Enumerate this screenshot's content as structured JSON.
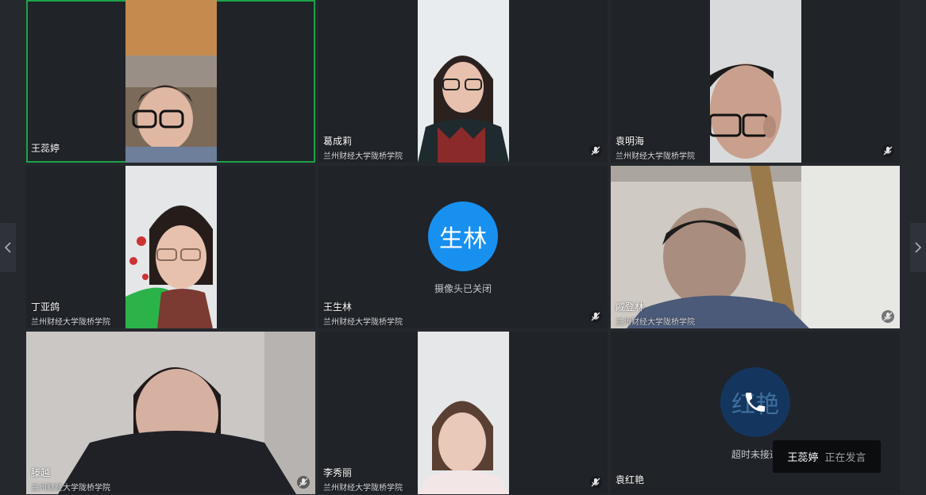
{
  "participants": [
    {
      "name": "王蕊婷",
      "org": "",
      "active": true,
      "mic_muted": false,
      "camera": "on"
    },
    {
      "name": "葛成莉",
      "org": "兰州财经大学陇桥学院",
      "active": false,
      "mic_muted": true,
      "camera": "on"
    },
    {
      "name": "袁明海",
      "org": "兰州财经大学陇桥学院",
      "active": false,
      "mic_muted": true,
      "camera": "on"
    },
    {
      "name": "丁亚鸽",
      "org": "兰州财经大学陇桥学院",
      "active": false,
      "mic_muted": false,
      "camera": "on"
    },
    {
      "name": "王生林",
      "org": "兰州财经大学陇桥学院",
      "active": false,
      "mic_muted": true,
      "camera": "off",
      "avatar_text": "生林",
      "avatar_color": "#1890f0",
      "camera_status": "摄像头已关闭"
    },
    {
      "name": "戚登林",
      "org": "兰州财经大学陇桥学院",
      "active": false,
      "mic_muted": true,
      "camera": "on"
    },
    {
      "name": "滕越",
      "org": "兰州财经大学陇桥学院",
      "active": false,
      "mic_muted": true,
      "camera": "on"
    },
    {
      "name": "李秀丽",
      "org": "兰州财经大学陇桥学院",
      "active": false,
      "mic_muted": true,
      "camera": "on"
    },
    {
      "name": "袁红艳",
      "org": "",
      "active": false,
      "mic_muted": false,
      "camera": "calling",
      "avatar_text": "红艳",
      "avatar_color": "#14365e",
      "call_status": "超时未接通"
    }
  ],
  "toast": {
    "speaker": "王蕊婷",
    "status": "正在发言"
  },
  "icons": {
    "mic_muted": "mic-muted-icon",
    "phone": "phone-icon",
    "prev": "chevron-left-icon",
    "next": "chevron-right-icon"
  },
  "colors": {
    "active_border": "#1ba34a",
    "background": "#25282d",
    "tile": "#202328"
  }
}
